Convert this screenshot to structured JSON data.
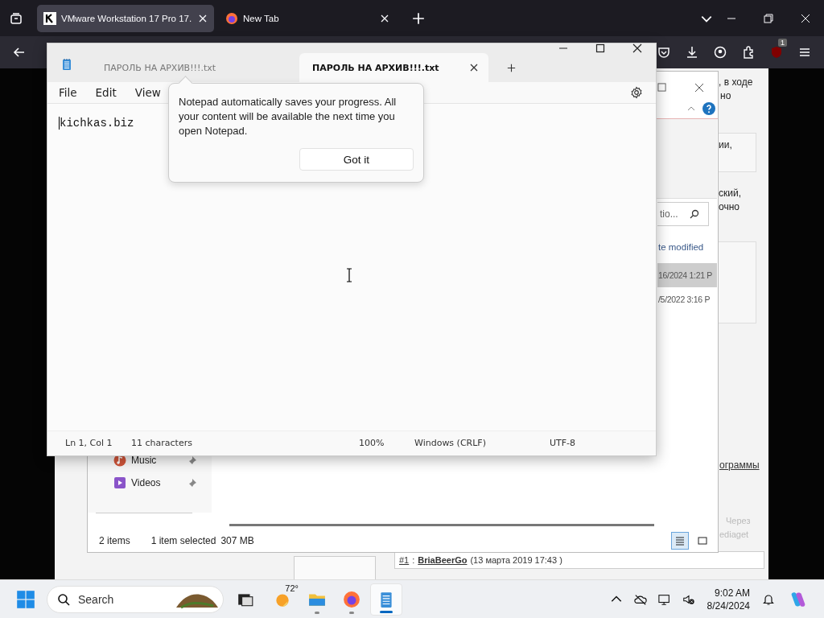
{
  "browser": {
    "tabs": [
      {
        "title": "VMware Workstation 17 Pro 17.",
        "selected": true
      },
      {
        "title": "New Tab",
        "selected": false
      }
    ],
    "extension_badge": "1"
  },
  "webpage": {
    "fragments": [
      {
        "text": ", в ходе",
        "kind": "text"
      },
      {
        "text": "но",
        "kind": "text"
      },
      {
        "text": "ии,",
        "kind": "text"
      },
      {
        "text": "ский,",
        "kind": "text"
      },
      {
        "text": "очно",
        "kind": "text"
      },
      {
        "text": "ограммы",
        "kind": "link"
      },
      {
        "text": "Через",
        "kind": "faded"
      },
      {
        "text": "ediaget",
        "kind": "faded"
      }
    ],
    "comment": {
      "number": "#1",
      "separator": ":",
      "author": "BriaBeerGo",
      "date": "(13 марта 2019 17:43 )"
    }
  },
  "explorer": {
    "search_placeholder": "tio...",
    "column": "te modified",
    "rows": [
      {
        "modified": "16/2024 1:21 P",
        "selected": true
      },
      {
        "modified": "/5/2022 3:16 P",
        "selected": false
      }
    ],
    "nav": [
      {
        "label": "Music",
        "kind": "music"
      },
      {
        "label": "Videos",
        "kind": "videos"
      }
    ],
    "status": {
      "items": "2 items",
      "selection": "1 item selected",
      "size": "307 MB"
    },
    "views": [
      {
        "kind": "details",
        "selected": true
      },
      {
        "kind": "tiles",
        "selected": false
      }
    ]
  },
  "notepad": {
    "tabs": [
      {
        "title": "ПАРОЛЬ НА АРХИВ!!!.txt",
        "selected": false
      },
      {
        "title": "ПАРОЛЬ НА АРХИВ!!!.txt",
        "selected": true
      }
    ],
    "menu": [
      "File",
      "Edit",
      "View"
    ],
    "content": "kichkas.biz",
    "tip": {
      "text": "Notepad automatically saves your progress. All your content will be available the next time you open Notepad.",
      "button": "Got it"
    },
    "status": [
      "Ln 1, Col 1",
      "11 characters",
      "100%",
      "Windows (CRLF)",
      "UTF-8"
    ]
  },
  "taskbar": {
    "search_placeholder": "Search",
    "weather": "72°",
    "apps": [
      {
        "kind": "taskview",
        "running": false,
        "selected": false
      },
      {
        "kind": "files",
        "running": true,
        "selected": false
      },
      {
        "kind": "firefox",
        "running": true,
        "selected": false
      },
      {
        "kind": "notepad",
        "running": true,
        "selected": true
      }
    ],
    "time": "9:02 AM",
    "date": "8/24/2024"
  }
}
